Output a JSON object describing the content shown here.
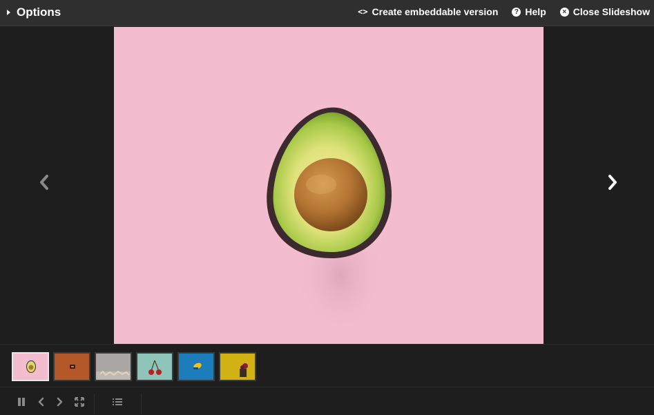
{
  "header": {
    "options_label": "Options",
    "embed_label": "Create embeddable version",
    "help_label": "Help",
    "close_label": "Close Slideshow",
    "embed_icon_text": "<>",
    "help_icon_text": "?",
    "close_icon_text": "×"
  },
  "slideshow": {
    "current_index": 1,
    "total": 6,
    "thumbnails": [
      {
        "subject": "avocado",
        "background": "#f3bccf",
        "active": true
      },
      {
        "subject": "orange-object",
        "background": "#b4582a",
        "active": false
      },
      {
        "subject": "grey-scene",
        "background": "#a9a6a4",
        "active": false
      },
      {
        "subject": "cherries",
        "background": "#8fc4bb",
        "active": false
      },
      {
        "subject": "yellow-object-on-blue",
        "background": "#1d7cba",
        "active": false
      },
      {
        "subject": "mustard-scene",
        "background": "#d2b114",
        "active": false
      }
    ]
  },
  "icons": {
    "options": "triangle-right-icon",
    "embed": "code-icon",
    "help": "help-icon",
    "close": "close-circle-icon",
    "prev": "chevron-left-icon",
    "next": "chevron-right-icon",
    "pause": "pause-icon",
    "fullscreen": "fullscreen-icon",
    "list": "list-icon"
  },
  "colors": {
    "topbar": "#2f2f2f",
    "background": "#1e1e1e",
    "slide_background": "#f3bccf",
    "icon_grey": "#8a8a8a"
  }
}
